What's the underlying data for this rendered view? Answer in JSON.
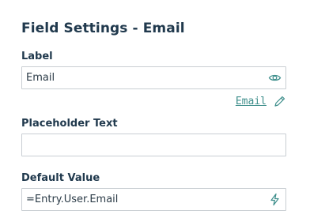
{
  "panel": {
    "title": "Field Settings - Email"
  },
  "label_field": {
    "label": "Label",
    "value": "Email",
    "icon": "eye-icon"
  },
  "email_link": {
    "text": "Email",
    "icon": "pencil-icon"
  },
  "placeholder_field": {
    "label": "Placeholder Text",
    "value": ""
  },
  "default_value_field": {
    "label": "Default Value",
    "value": "=Entry.User.Email",
    "icon": "lightning-icon"
  },
  "colors": {
    "heading": "#20394d",
    "accent": "#3f8f8c",
    "border": "#c9ced3"
  }
}
